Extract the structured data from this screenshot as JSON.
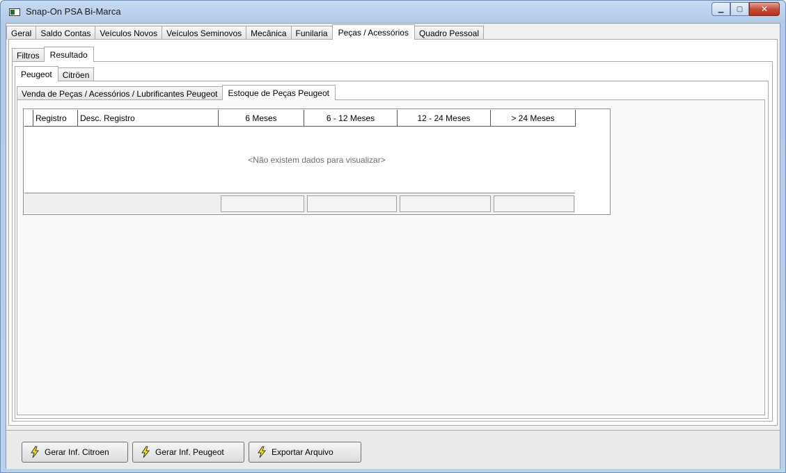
{
  "window": {
    "title": "Snap-On PSA Bi-Marca",
    "controls": {
      "minimize": "▁",
      "maximize": "▢",
      "close": "✕"
    }
  },
  "main_tabs": [
    "Geral",
    "Saldo Contas",
    "Veículos Novos",
    "Veículos Seminovos",
    "Mecânica",
    "Funilaria",
    "Peças / Acessórios",
    "Quadro Pessoal"
  ],
  "main_tab_active": "Peças / Acessórios",
  "sub_tabs": [
    "Filtros",
    "Resultado"
  ],
  "sub_tab_active": "Resultado",
  "brand_tabs": [
    "Peugeot",
    "Citröen"
  ],
  "brand_tab_active": "Peugeot",
  "report_tabs": [
    "Venda de Peças / Acessórios / Lubrificantes Peugeot",
    "Estoque de Peças Peugeot"
  ],
  "report_tab_active": "Estoque de Peças Peugeot",
  "grid": {
    "columns": [
      "Registro",
      "Desc. Registro",
      "6 Meses",
      "6 - 12 Meses",
      "12 - 24 Meses",
      "> 24 Meses"
    ],
    "empty_text": "<Não existem dados para visualizar>"
  },
  "buttons": {
    "gerar_citroen": "Gerar Inf. Citroen",
    "gerar_peugeot": "Gerar Inf. Peugeot",
    "exportar": "Exportar Arquivo"
  },
  "icons": {
    "button_icon": "lightning-bolt-icon",
    "app_icon": "window-app-icon"
  },
  "colors": {
    "bolt_fill": "#f5e600",
    "bolt_stroke": "#333333"
  }
}
